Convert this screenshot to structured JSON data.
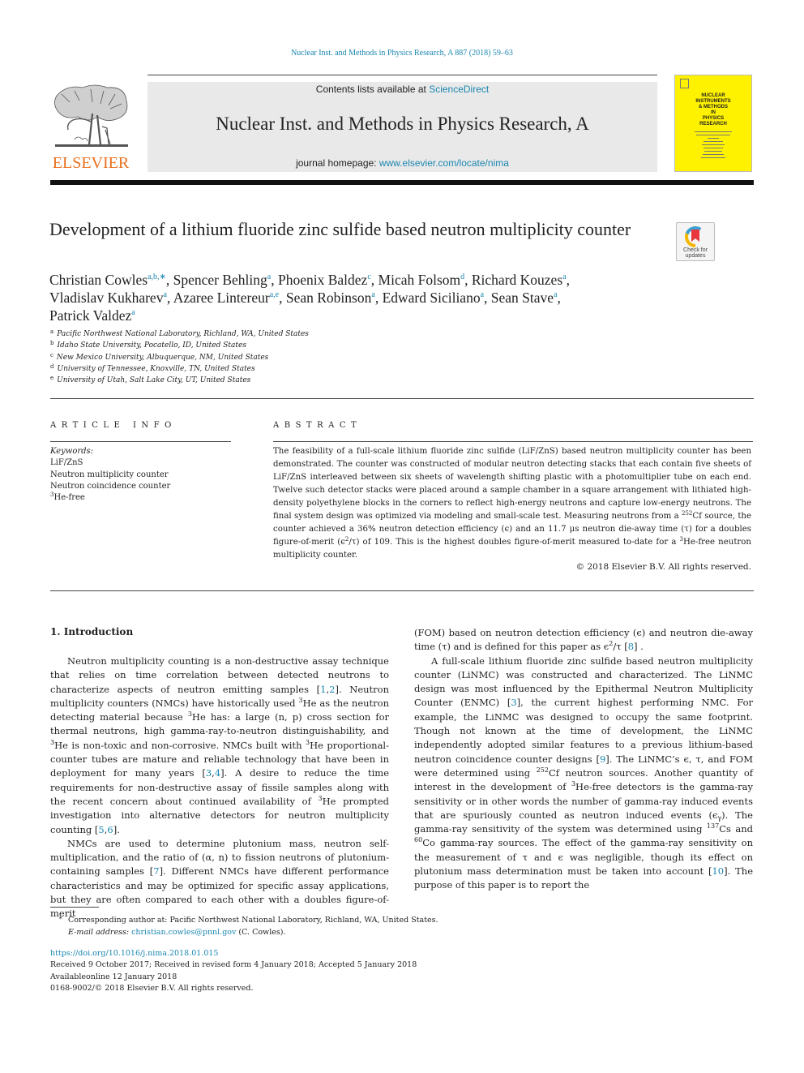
{
  "journal": {
    "running_head": "Nuclear Inst. and Methods in Physics Research, A 887 (2018) 59–63",
    "contents_prefix": "Contents lists available at ",
    "contents_link": "ScienceDirect",
    "title": "Nuclear Inst. and Methods in Physics Research, A",
    "homepage_prefix": "journal homepage: ",
    "homepage_link": "www.elsevier.com/locate/nima",
    "publisher_logo_text": "ELSEVIER",
    "cover_title": "NUCLEAR\nINSTRUMENTS\n& METHODS\nIN\nPHYSICS\nRESEARCH",
    "accent_color": "#1a86b0",
    "publisher_color": "#e8701d",
    "cover_color": "#fff200"
  },
  "article": {
    "title": "Development of a lithium fluoride zinc sulfide based neutron multiplicity counter",
    "check_updates_label": "Check for updates",
    "authors": [
      {
        "name": "Christian Cowles",
        "aff": "a,b,∗"
      },
      {
        "name": "Spencer Behling",
        "aff": "a"
      },
      {
        "name": "Phoenix Baldez",
        "aff": "c"
      },
      {
        "name": "Micah Folsom",
        "aff": "d"
      },
      {
        "name": "Richard Kouzes",
        "aff": "a"
      },
      {
        "name": "Vladislav Kukharev",
        "aff": "a"
      },
      {
        "name": "Azaree Lintereur",
        "aff": "a,e"
      },
      {
        "name": "Sean Robinson",
        "aff": "a"
      },
      {
        "name": "Edward Siciliano",
        "aff": "a"
      },
      {
        "name": "Sean Stave",
        "aff": "a"
      },
      {
        "name": "Patrick Valdez",
        "aff": "a"
      }
    ],
    "affiliations": [
      {
        "key": "a",
        "text": "Pacific Northwest National Laboratory, Richland, WA, United States"
      },
      {
        "key": "b",
        "text": "Idaho State University, Pocatello, ID, United States"
      },
      {
        "key": "c",
        "text": "New Mexico University, Albuquerque, NM, United States"
      },
      {
        "key": "d",
        "text": "University of Tennessee, Knoxville, TN, United States"
      },
      {
        "key": "e",
        "text": "University of Utah, Salt Lake City, UT, United States"
      }
    ]
  },
  "article_info": {
    "heading": "ARTICLE INFO",
    "keywords_label": "Keywords:",
    "keywords": [
      "LiF/ZnS",
      "Neutron multiplicity counter",
      "Neutron coincidence counter",
      "He-free"
    ],
    "keyword_4_sup": "3"
  },
  "abstract": {
    "heading": "ABSTRACT",
    "s1": "The feasibility of a full-scale lithium fluoride zinc sulfide (LiF/ZnS) based neutron multiplicity counter has been demonstrated. The counter was constructed of modular neutron detecting stacks that each contain five sheets of LiF/ZnS interleaved between six sheets of wavelength shifting plastic with a photomultiplier tube on each end. Twelve such detector stacks were placed around a sample chamber in a square arrangement with lithiated high-density polyethylene blocks in the corners to reflect high-energy neutrons and capture low-energy neutrons. The final system design was optimized via modeling and small-scale test. Measuring neutrons from a ",
    "sup1": "252",
    "s2": "Cf source, the counter achieved a 36% neutron detection efficiency (ϵ) and an 11.7 μs neutron die-away time (τ) for a doubles figure-of-merit (ϵ",
    "sup2": "2",
    "s3": "/τ) of 109. This is the highest doubles figure-of-merit measured to-date for a ",
    "sup3": "3",
    "s4": "He-free neutron multiplicity counter.",
    "copyright": "© 2018 Elsevier B.V. All rights reserved."
  },
  "intro": {
    "heading": "1.  Introduction",
    "p1": [
      {
        "t": "Neutron multiplicity counting is a non-destructive assay technique that relies on time correlation between detected neutrons to characterize aspects of neutron emitting samples ["
      },
      {
        "link": "1"
      },
      {
        "t": ","
      },
      {
        "link": "2"
      },
      {
        "t": "]. Neutron multiplicity counters (NMCs) have historically used "
      },
      {
        "sup": "3"
      },
      {
        "t": "He as the neutron detecting material because "
      },
      {
        "sup": "3"
      },
      {
        "t": "He has: a large (n, p) cross section for thermal neutrons, high gamma-ray-to-neutron distinguishability, and "
      },
      {
        "sup": "3"
      },
      {
        "t": "He is non-toxic and non-corrosive. NMCs built with "
      },
      {
        "sup": "3"
      },
      {
        "t": "He proportional-counter tubes are mature and reliable technology that have been in deployment for many years ["
      },
      {
        "link": "3"
      },
      {
        "t": ","
      },
      {
        "link": "4"
      },
      {
        "t": "]. A desire to reduce the time requirements for non-destructive assay of fissile samples along with the recent concern about continued availability of "
      },
      {
        "sup": "3"
      },
      {
        "t": "He prompted investigation into alternative detectors for neutron multiplicity counting ["
      },
      {
        "link": "5"
      },
      {
        "t": ","
      },
      {
        "link": "6"
      },
      {
        "t": "]."
      }
    ],
    "p2": [
      {
        "t": "NMCs are used to determine plutonium mass, neutron self-multiplication, and the ratio of (α, n) to fission neutrons of plutonium-containing samples ["
      },
      {
        "link": "7"
      },
      {
        "t": "]. Different NMCs have different performance characteristics and may be optimized for specific assay applications, but they are often compared to each other with a doubles figure-of-merit"
      }
    ],
    "p3": [
      {
        "t": "(FOM) based on neutron detection efficiency (ϵ) and neutron die-away time (τ) and is defined for this paper as ϵ"
      },
      {
        "sup": "2"
      },
      {
        "t": "/τ ["
      },
      {
        "link": "8"
      },
      {
        "t": "] ."
      }
    ],
    "p4": [
      {
        "t": "A full-scale lithium fluoride zinc sulfide based neutron multiplicity counter (LiNMC) was constructed and characterized. The LiNMC design was most influenced by the Epithermal Neutron Multiplicity Counter (ENMC) ["
      },
      {
        "link": "3"
      },
      {
        "t": "], the current highest performing NMC. For example, the LiNMC was designed to occupy the same footprint. Though not known at the time of development, the LiNMC independently adopted similar features to a previous lithium-based neutron coincidence counter designs ["
      },
      {
        "link": "9"
      },
      {
        "t": "]. The LiNMC’s ϵ, τ, and FOM were determined using "
      },
      {
        "sup": "252"
      },
      {
        "t": "Cf neutron sources. Another quantity of interest in the development of "
      },
      {
        "sup": "3"
      },
      {
        "t": "He-free detectors is the gamma-ray sensitivity or in other words the number of gamma-ray induced events that are spuriously counted as neutron induced events (ϵ"
      },
      {
        "sub": "γ"
      },
      {
        "t": "). The gamma-ray sensitivity of the system was determined using "
      },
      {
        "sup": "137"
      },
      {
        "t": "Cs and "
      },
      {
        "sup": "60"
      },
      {
        "t": "Co gamma-ray sources. The effect of the gamma-ray sensitivity on the measurement of τ and ϵ was negligible, though its effect on plutonium mass determination must be taken into account ["
      },
      {
        "link": "10"
      },
      {
        "t": "]. The purpose of this paper is to report the"
      }
    ]
  },
  "footnote": {
    "star": "∗",
    "corresponding": "Corresponding author at: Pacific Northwest National Laboratory, Richland, WA, United States.",
    "email_label": "E-mail address: ",
    "email": "christian.cowles@pnnl.gov",
    "email_suffix": " (C. Cowles)."
  },
  "pubinfo": {
    "doi": "https://doi.org/10.1016/j.nima.2018.01.015",
    "history": "Received 9 October 2017; Received in revised form 4 January 2018; Accepted 5 January 2018",
    "online": "Availableonline 12 January 2018",
    "issn": "0168-9002/© 2018 Elsevier B.V. All rights reserved."
  }
}
